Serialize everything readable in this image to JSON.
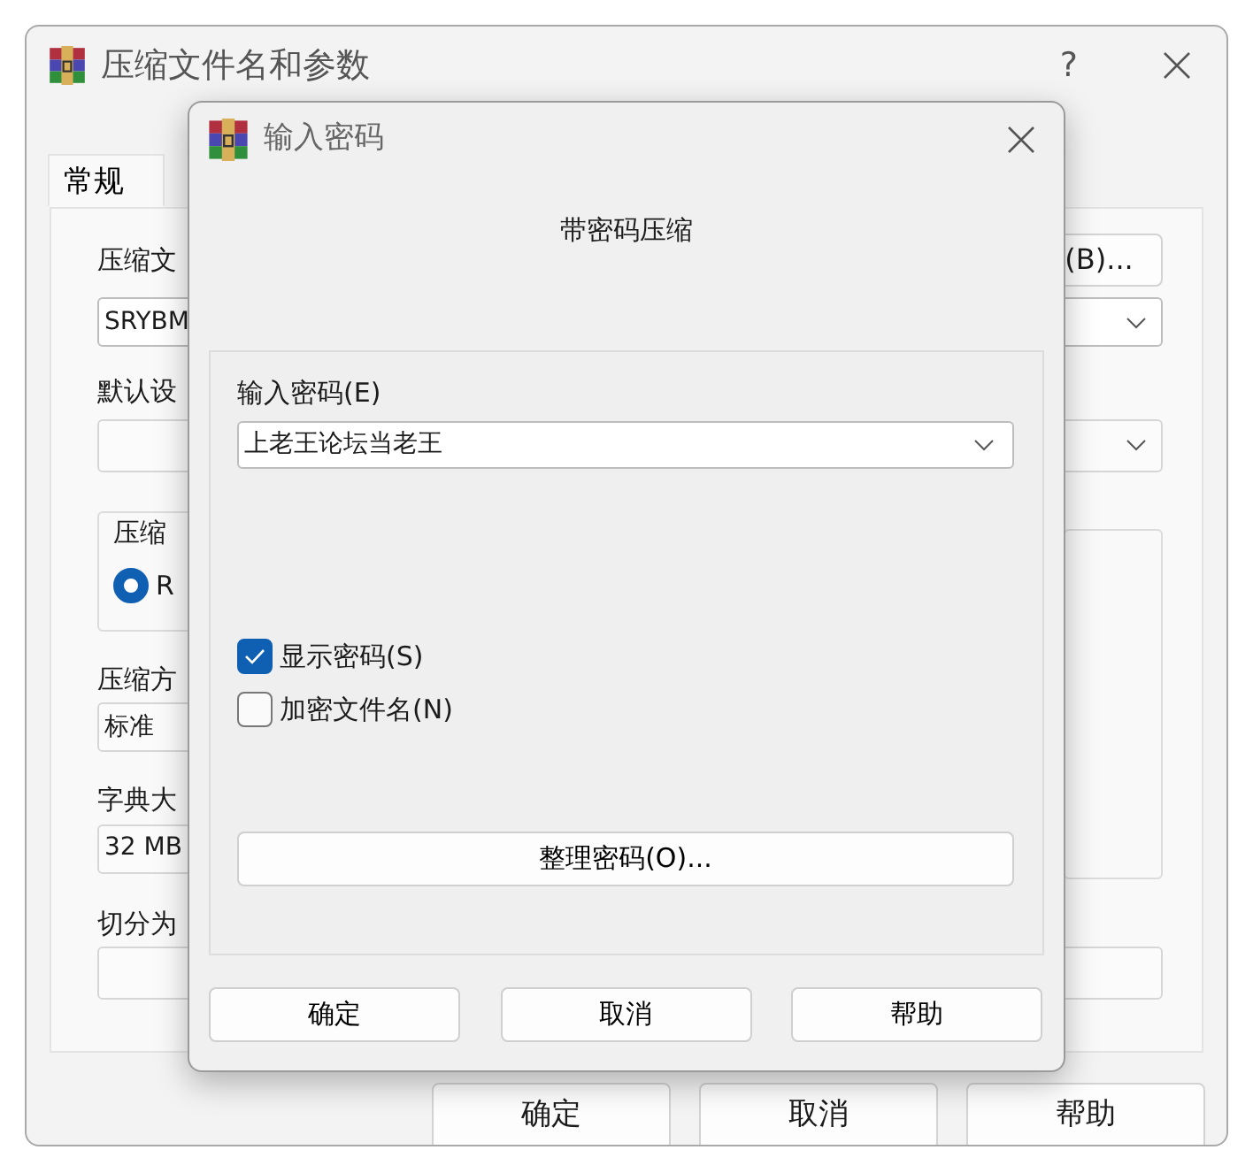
{
  "main_window": {
    "title": "压缩文件名和参数",
    "help": "?",
    "tabs": [
      {
        "label": "常规",
        "selected": true
      }
    ],
    "general": {
      "archive_name_label": "压缩文",
      "browse_button": "(B)...",
      "archive_name": "SRYBM",
      "profile_label": "默认设",
      "format_group_label": "压缩",
      "format_option": {
        "label": "R",
        "selected": true
      },
      "method_label": "压缩方",
      "method": "标准",
      "dictionary_label": "字典大",
      "dictionary": "32 MB",
      "split_label": "切分为"
    },
    "buttons": [
      "确定",
      "取消",
      "帮助"
    ]
  },
  "password_dialog": {
    "title": "输入密码",
    "heading": "带密码压缩",
    "password_label": "输入密码(E)",
    "password": "上老王论坛当老王",
    "options": [
      {
        "label": "显示密码(S)",
        "checked": true
      },
      {
        "label": "加密文件名(N)",
        "checked": false
      }
    ],
    "organize_button": "整理密码(O)...",
    "buttons": [
      "确定",
      "取消",
      "帮助"
    ]
  }
}
